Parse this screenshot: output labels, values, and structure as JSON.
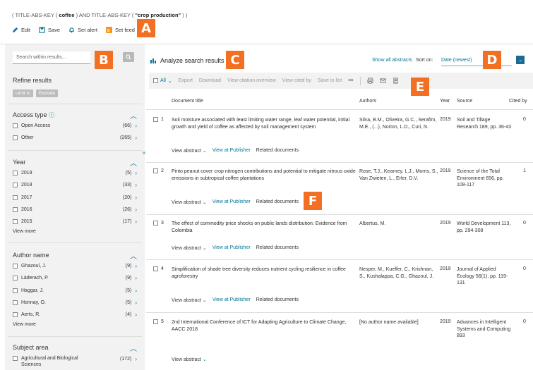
{
  "query": {
    "pre": "( TITLE-ABS-KEY ( ",
    "term1": "coffee",
    "mid": " )  AND  TITLE-ABS-KEY ( ",
    "term2": "\"crop production\"",
    "post": " ) )"
  },
  "toolbar": {
    "edit": "Edit",
    "save": "Save",
    "alert": "Set alert",
    "feed": "Set feed"
  },
  "sidebar": {
    "search_placeholder": "Search within results...",
    "refine_title": "Refine results",
    "limit_to": "Limit to",
    "exclude": "Exclude",
    "access": {
      "title": "Access type",
      "items": [
        {
          "label": "Open Access",
          "count": "(66)"
        },
        {
          "label": "Other",
          "count": "(265)"
        }
      ]
    },
    "year": {
      "title": "Year",
      "items": [
        {
          "label": "2019",
          "count": "(5)"
        },
        {
          "label": "2018",
          "count": "(33)"
        },
        {
          "label": "2017",
          "count": "(20)"
        },
        {
          "label": "2016",
          "count": "(26)"
        },
        {
          "label": "2015",
          "count": "(17)"
        }
      ],
      "view_more": "View more"
    },
    "author": {
      "title": "Author name",
      "items": [
        {
          "label": "Ghazoul, J.",
          "count": "(9)"
        },
        {
          "label": "Läderach, P.",
          "count": "(9)"
        },
        {
          "label": "Haggar, J.",
          "count": "(5)"
        },
        {
          "label": "Honnay, O.",
          "count": "(5)"
        },
        {
          "label": "Aerts, R.",
          "count": "(4)"
        }
      ],
      "view_more": "View more"
    },
    "subject": {
      "title": "Subject area",
      "items": [
        {
          "label": "Agricultural and Biological Sciences",
          "count": "(172)"
        }
      ]
    }
  },
  "main": {
    "analyze": "Analyze search results",
    "show_all": "Show all abstracts",
    "sort_label": "Sort on:",
    "sort_value": "Date (newest)",
    "actions": {
      "all": "All",
      "export": "Export",
      "download": "Download",
      "citation": "View citation overview",
      "cited_by": "View cited by",
      "save": "Save to list",
      "more": "•••"
    },
    "headers": {
      "title": "Document title",
      "authors": "Authors",
      "year": "Year",
      "source": "Source",
      "cited": "Cited by"
    },
    "results": [
      {
        "num": "1",
        "title": "Soil moisture associated with least limiting water range, leaf water potential, initial growth and yield of coffee as affected by soil management system",
        "authors": "Silva, B.M., Oliveira, G.C., Serafim, M.E., (...), Norton, L.D., Curi, N.",
        "year": "2019",
        "source": "Soil and Tillage Research 189, pp. 36-43",
        "cited": "0",
        "va": "View abstract",
        "vp": "View at Publisher",
        "rd": "Related documents"
      },
      {
        "num": "2",
        "title": "Pinto peanut cover crop nitrogen contributions and potential to mitigate nitrous oxide emissions in subtropical coffee plantations",
        "authors": "Rose, T.J., Kearney, L.J., Morris, S., Van Zwieten, L., Erler, D.V.",
        "year": "2019",
        "source": "Science of the Total Environment 656, pp. 108-117",
        "cited": "1",
        "va": "View abstract",
        "vp": "View at Publisher",
        "rd": "Related documents"
      },
      {
        "num": "3",
        "title": "The effect of commodity price shocks on public lands distribution: Evidence from Colombia",
        "authors": "Albertus, M.",
        "year": "2019",
        "source": "World Development 113, pp. 294-308",
        "cited": "0",
        "va": "View abstract",
        "vp": "View at Publisher",
        "rd": "Related documents"
      },
      {
        "num": "4",
        "title": "Simplification of shade tree diversity reduces nutrient cycling resilience in coffee agroforestry",
        "authors": "Nesper, M., Kueffer, C., Krishnan, S., Kushalappa, C.G., Ghazoul, J.",
        "year": "2019",
        "source": "Journal of Applied Ecology 56(1), pp. 119-131",
        "cited": "0",
        "va": "View abstract",
        "vp": "View at Publisher",
        "rd": "Related documents"
      },
      {
        "num": "5",
        "title": "2nd International Conference of ICT for Adapting Agriculture to Climate Change, AACC 2018",
        "authors": "[No author name available]",
        "year": "2019",
        "source": "Advances in Intelligent Systems and Computing 893",
        "cited": "0",
        "va": "View abstract",
        "vp": "",
        "rd": ""
      }
    ]
  },
  "badges": {
    "a": "A",
    "b": "B",
    "c": "C",
    "d": "D",
    "e": "E",
    "f": "F"
  },
  "colors": {
    "link": "#007398",
    "badge": "#f36f21",
    "panel": "#f2f2f2"
  }
}
